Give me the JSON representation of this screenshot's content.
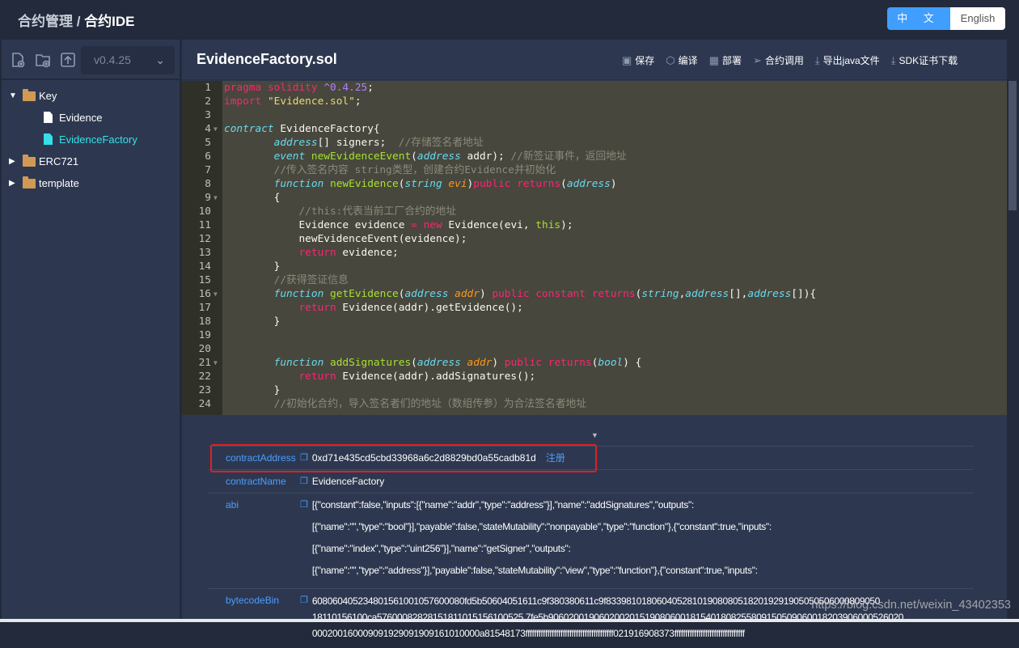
{
  "header": {
    "breadcrumb_parent": "合约管理",
    "breadcrumb_sep": " / ",
    "breadcrumb_current": "合约IDE",
    "lang_zh": "中 文",
    "lang_en": "English",
    "accent": "#409eff"
  },
  "sidebar": {
    "version": "v0.4.25",
    "tools": [
      "new-file-icon",
      "new-folder-icon",
      "upload-icon"
    ],
    "tree": [
      {
        "label": "Key",
        "type": "folder",
        "open": true
      },
      {
        "label": "Evidence",
        "type": "file"
      },
      {
        "label": "EvidenceFactory",
        "type": "file",
        "active": true
      },
      {
        "label": "ERC721",
        "type": "folder",
        "open": false
      },
      {
        "label": "template",
        "type": "folder",
        "open": false
      }
    ]
  },
  "editor": {
    "filename": "EvidenceFactory.sol",
    "actions": [
      {
        "icon": "save-icon",
        "label": "保存"
      },
      {
        "icon": "compile-icon",
        "label": "编译"
      },
      {
        "icon": "deploy-icon",
        "label": "部署"
      },
      {
        "icon": "send-icon",
        "label": "合约调用"
      },
      {
        "icon": "download-icon",
        "label": "导出java文件"
      },
      {
        "icon": "download-icon",
        "label": "SDK证书下载"
      }
    ],
    "fold_lines": [
      4,
      9,
      16,
      21
    ],
    "lines": [
      [
        [
          "k",
          "pragma"
        ],
        [
          "w",
          " "
        ],
        [
          "k",
          "solidity"
        ],
        [
          "w",
          " "
        ],
        [
          "n",
          "^0.4.25"
        ],
        [
          "w",
          ";"
        ]
      ],
      [
        [
          "k",
          "import"
        ],
        [
          "w",
          " "
        ],
        [
          "s",
          "\"Evidence.sol\""
        ],
        [
          "w",
          ";"
        ]
      ],
      [],
      [
        [
          "t",
          "contract"
        ],
        [
          "w",
          " EvidenceFactory{"
        ]
      ],
      [
        [
          "w",
          "        "
        ],
        [
          "t",
          "address"
        ],
        [
          "w",
          "[] signers;  "
        ],
        [
          "c",
          "//存储签名者地址"
        ]
      ],
      [
        [
          "w",
          "        "
        ],
        [
          "t",
          "event"
        ],
        [
          "w",
          " "
        ],
        [
          "f",
          "newEvidenceEvent"
        ],
        [
          "w",
          "("
        ],
        [
          "t",
          "address"
        ],
        [
          "w",
          " addr); "
        ],
        [
          "c",
          "//新签证事件，返回地址"
        ]
      ],
      [
        [
          "c",
          "        //传入签名内容 string类型，创建合约Evidence并初始化"
        ]
      ],
      [
        [
          "w",
          "        "
        ],
        [
          "t",
          "function"
        ],
        [
          "w",
          " "
        ],
        [
          "f",
          "newEvidence"
        ],
        [
          "w",
          "("
        ],
        [
          "t",
          "string"
        ],
        [
          "w",
          " "
        ],
        [
          "p",
          "evi"
        ],
        [
          "w",
          ")"
        ],
        [
          "k",
          "public"
        ],
        [
          "w",
          " "
        ],
        [
          "k",
          "returns"
        ],
        [
          "w",
          "("
        ],
        [
          "t",
          "address"
        ],
        [
          "w",
          ")"
        ]
      ],
      [
        [
          "w",
          "        {"
        ]
      ],
      [
        [
          "c",
          "            //this:代表当前工厂合约的地址"
        ]
      ],
      [
        [
          "w",
          "            Evidence evidence "
        ],
        [
          "k",
          "="
        ],
        [
          "w",
          " "
        ],
        [
          "k",
          "new"
        ],
        [
          "w",
          " Evidence(evi, "
        ],
        [
          "f",
          "this"
        ],
        [
          "w",
          ");"
        ]
      ],
      [
        [
          "w",
          "            newEvidenceEvent(evidence);"
        ]
      ],
      [
        [
          "w",
          "            "
        ],
        [
          "k",
          "return"
        ],
        [
          "w",
          " evidence;"
        ]
      ],
      [
        [
          "w",
          "        }"
        ]
      ],
      [
        [
          "c",
          "        //获得签证信息"
        ]
      ],
      [
        [
          "w",
          "        "
        ],
        [
          "t",
          "function"
        ],
        [
          "w",
          " "
        ],
        [
          "f",
          "getEvidence"
        ],
        [
          "w",
          "("
        ],
        [
          "t",
          "address"
        ],
        [
          "w",
          " "
        ],
        [
          "p",
          "addr"
        ],
        [
          "w",
          ") "
        ],
        [
          "k",
          "public"
        ],
        [
          "w",
          " "
        ],
        [
          "k",
          "constant"
        ],
        [
          "w",
          " "
        ],
        [
          "k",
          "returns"
        ],
        [
          "w",
          "("
        ],
        [
          "t",
          "string"
        ],
        [
          "w",
          ","
        ],
        [
          "t",
          "address"
        ],
        [
          "w",
          "[],"
        ],
        [
          "t",
          "address"
        ],
        [
          "w",
          "[]){"
        ]
      ],
      [
        [
          "w",
          "            "
        ],
        [
          "k",
          "return"
        ],
        [
          "w",
          " Evidence(addr).getEvidence();"
        ]
      ],
      [
        [
          "w",
          "        }"
        ]
      ],
      [],
      [],
      [
        [
          "w",
          "        "
        ],
        [
          "t",
          "function"
        ],
        [
          "w",
          " "
        ],
        [
          "f",
          "addSignatures"
        ],
        [
          "w",
          "("
        ],
        [
          "t",
          "address"
        ],
        [
          "w",
          " "
        ],
        [
          "p",
          "addr"
        ],
        [
          "w",
          ") "
        ],
        [
          "k",
          "public"
        ],
        [
          "w",
          " "
        ],
        [
          "k",
          "returns"
        ],
        [
          "w",
          "("
        ],
        [
          "t",
          "bool"
        ],
        [
          "w",
          ") {"
        ]
      ],
      [
        [
          "w",
          "            "
        ],
        [
          "k",
          "return"
        ],
        [
          "w",
          " Evidence(addr).addSignatures();"
        ]
      ],
      [
        [
          "w",
          "        }"
        ]
      ],
      [
        [
          "c",
          "        //初始化合约，导入签名者们的地址（数组传参）为合法签名者地址"
        ]
      ]
    ]
  },
  "result": {
    "rows": [
      {
        "key": "contractAddress",
        "lines": [
          "0xd71e435cd5cbd33968a6c2d8829bd0a55cadb81d"
        ],
        "link": "注册"
      },
      {
        "key": "contractName",
        "lines": [
          "EvidenceFactory"
        ]
      },
      {
        "key": "abi",
        "lines": [
          "[{\"constant\":false,\"inputs\":[{\"name\":\"addr\",\"type\":\"address\"}],\"name\":\"addSignatures\",\"outputs\":",
          "[{\"name\":\"\",\"type\":\"bool\"}],\"payable\":false,\"stateMutability\":\"nonpayable\",\"type\":\"function\"},{\"constant\":true,\"inputs\":",
          "[{\"name\":\"index\",\"type\":\"uint256\"}],\"name\":\"getSigner\",\"outputs\":",
          "[{\"name\":\"\",\"type\":\"address\"}],\"payable\":false,\"stateMutability\":\"view\",\"type\":\"function\"},{\"constant\":true,\"inputs\":"
        ]
      },
      {
        "key": "bytecodeBin",
        "lines": [
          "608060405234801561001057600080fd5b50604051611c9f380380611c9f833981018060405281019080805182019291905050506000809050",
          "18110156100ca57600082828151811015156100525 7fe5b9060200190602002015190806001815401808255809150509060018203906000526020",
          "000200160009091929091909161010000a81548173ffffffffffffffffffffffffffffffffffffffff021916908373ffffffffffffffffffffffffffffffff"
        ]
      }
    ]
  },
  "watermark": "https://blog.csdn.net/weixin_43402353"
}
